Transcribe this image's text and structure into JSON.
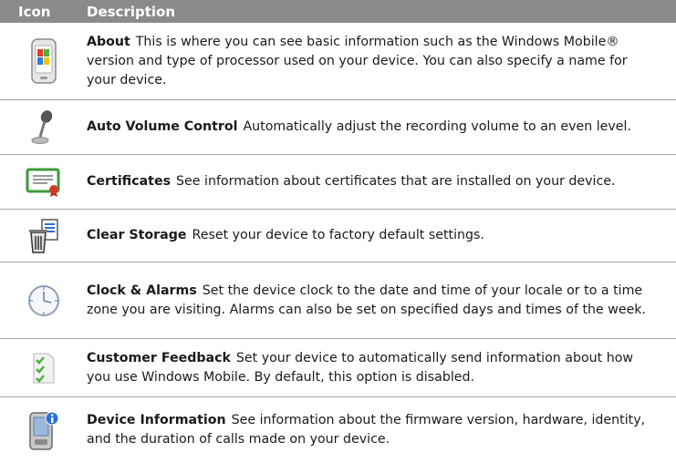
{
  "header": {
    "col_icon": "Icon",
    "col_description": "Description"
  },
  "rows": [
    {
      "title": "About",
      "icon": "windows-phone-icon",
      "text": "This is where you can see basic information such as the Windows Mobile® version and type of processor used on your device. You can also specify a name for your device."
    },
    {
      "title": "Auto Volume Control",
      "icon": "microphone-icon",
      "text": "Automatically adjust the recording volume to an even level."
    },
    {
      "title": "Certificates",
      "icon": "certificate-icon",
      "text": "See information about certificates that are installed on your device."
    },
    {
      "title": "Clear Storage",
      "icon": "trash-document-icon",
      "text": "Reset your device to factory default settings."
    },
    {
      "title": "Clock & Alarms",
      "icon": "clock-icon",
      "text": "Set the device clock to the date and time of your locale or to a time zone you are visiting. Alarms can also be set on specified days and times of the week."
    },
    {
      "title": "Customer Feedback",
      "icon": "checklist-icon",
      "text": "Set your device to automatically send information about how you use Windows Mobile. By default, this option is disabled."
    },
    {
      "title": "Device Information",
      "icon": "device-info-icon",
      "text": "See information about the firmware version, hardware, identity, and the duration of calls made on your device."
    }
  ]
}
